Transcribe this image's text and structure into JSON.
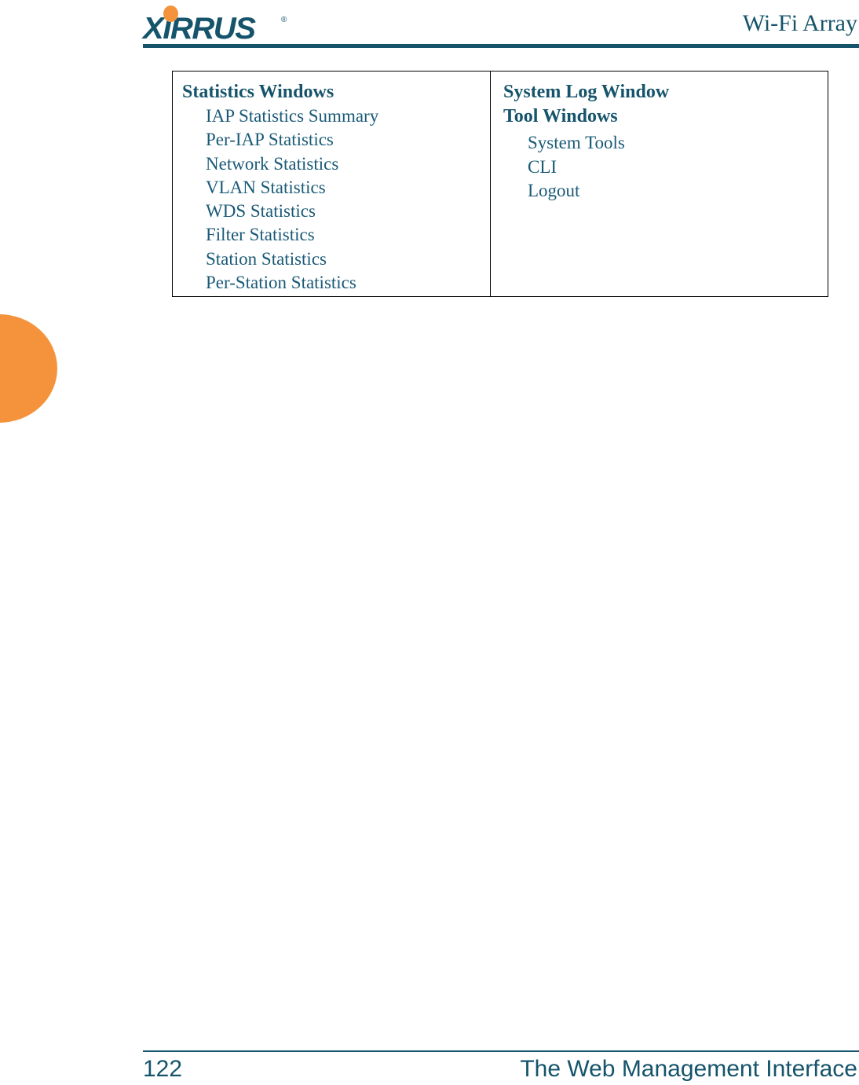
{
  "header": {
    "logo_text": "XIRRUS",
    "logo_registered_mark": "®",
    "product_title": "Wi-Fi Array"
  },
  "table": {
    "columns": [
      {
        "groups": [
          {
            "heading": "Statistics Windows",
            "entries": [
              "IAP Statistics Summary",
              "Per-IAP Statistics",
              "Network Statistics",
              "VLAN Statistics",
              "WDS Statistics",
              "Filter Statistics",
              "Station Statistics",
              "Per-Station Statistics"
            ]
          }
        ]
      },
      {
        "groups": [
          {
            "heading": "System Log Window",
            "entries": []
          },
          {
            "heading": "Tool Windows",
            "entries": [
              "System Tools",
              "CLI",
              "Logout"
            ]
          }
        ]
      }
    ]
  },
  "footer": {
    "page_number": "122",
    "chapter_title": "The Web Management Interface"
  },
  "colors": {
    "brand_teal": "#15546B",
    "body_teal": "#1A5A77",
    "accent_orange": "#F5933C",
    "rule_black": "#000000"
  }
}
